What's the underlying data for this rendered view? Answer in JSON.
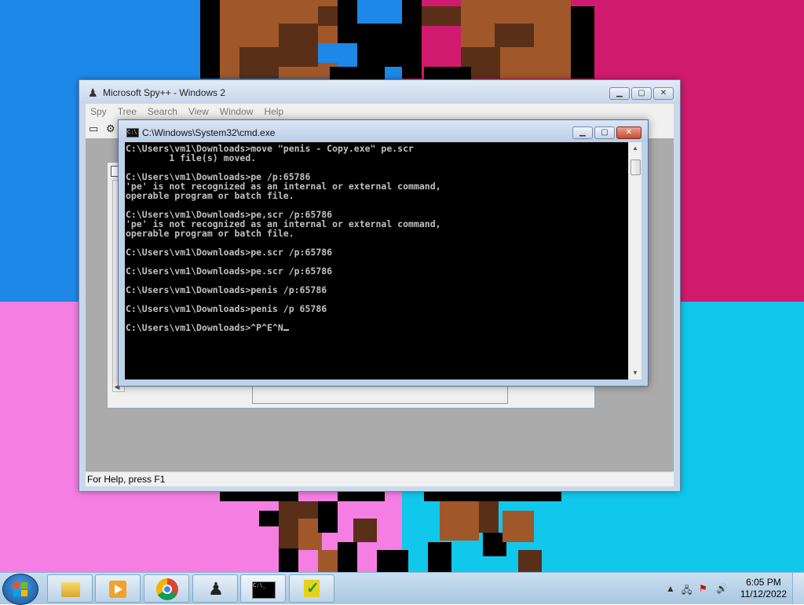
{
  "spy_window": {
    "title": "Microsoft Spy++ - Windows 2",
    "menu": [
      "Spy",
      "Tree",
      "Search",
      "View",
      "Window",
      "Help"
    ],
    "mdi_child_title_stub": "W",
    "status": "For Help, press F1",
    "icon": "spy-icon"
  },
  "cmd_window": {
    "title": "C:\\Windows\\System32\\cmd.exe",
    "icon": "console-icon",
    "lines": [
      "C:\\Users\\vm1\\Downloads>move \"penis - Copy.exe\" pe.scr",
      "        1 file(s) moved.",
      "",
      "C:\\Users\\vm1\\Downloads>pe /p:65786",
      "'pe' is not recognized as an internal or external command,",
      "operable program or batch file.",
      "",
      "C:\\Users\\vm1\\Downloads>pe,scr /p:65786",
      "'pe' is not recognized as an internal or external command,",
      "operable program or batch file.",
      "",
      "C:\\Users\\vm1\\Downloads>pe.scr /p:65786",
      "",
      "C:\\Users\\vm1\\Downloads>pe.scr /p:65786",
      "",
      "C:\\Users\\vm1\\Downloads>penis /p:65786",
      "",
      "C:\\Users\\vm1\\Downloads>penis /p 65786",
      "",
      "C:\\Users\\vm1\\Downloads>^P^E^N"
    ]
  },
  "taskbar": {
    "items": [
      "explorer-icon",
      "media-player-icon",
      "chrome-icon",
      "spy-icon",
      "cmd-icon",
      "checkmark-app-icon"
    ],
    "time": "6:05 PM",
    "date": "11/12/2022"
  },
  "colors": {
    "wallpaper_tl": "#1e88e8",
    "wallpaper_tr": "#d01a6e",
    "wallpaper_bl": "#f47ee2",
    "wallpaper_br": "#10c8ec",
    "sprite_brown": "#a0582a",
    "sprite_dark": "#5a2f18"
  }
}
